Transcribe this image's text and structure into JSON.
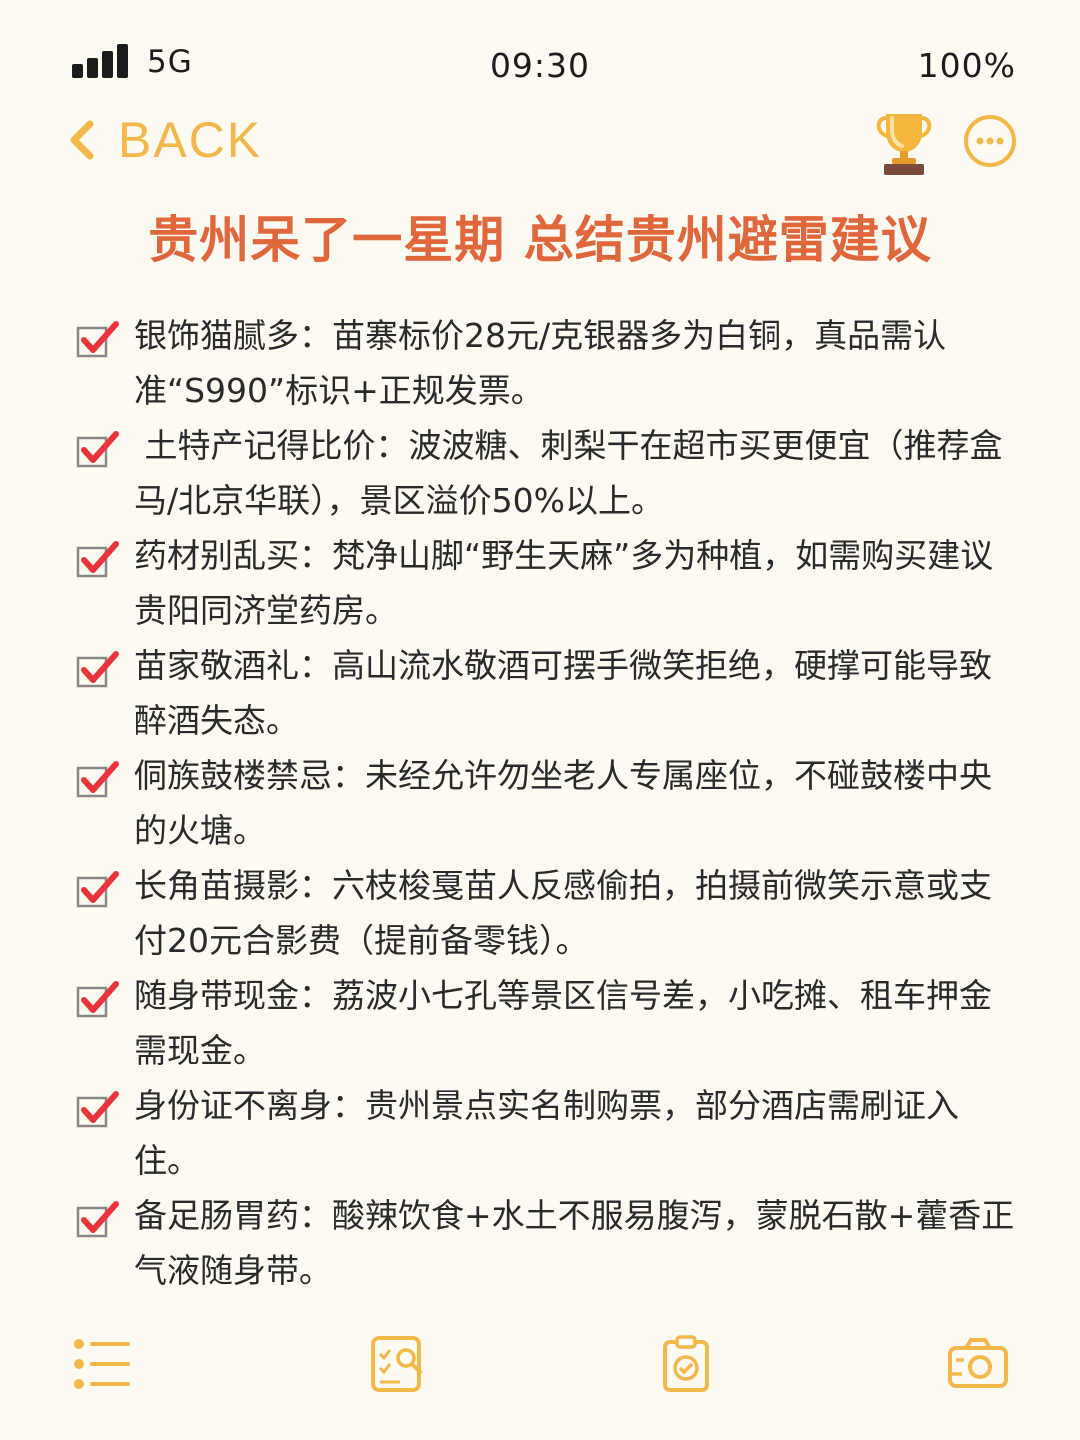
{
  "status_bar": {
    "network": "5G",
    "time": "09:30",
    "battery": "100%"
  },
  "nav": {
    "back_label": "BACK",
    "icons": [
      "chevron-left-icon",
      "trophy-icon",
      "more-icon"
    ]
  },
  "title": "贵州呆了一星期 总结贵州避雷建议",
  "items": [
    {
      "text": "银饰猫腻多：苗寨标价28元/克银器多为白铜，真品需认准“S990”标识+正规发票。"
    },
    {
      "text": " 土特产记得比价：波波糖、刺梨干在超市买更便宜（推荐盒马/北京华联），景区溢价50%以上。"
    },
    {
      "text": "药材别乱买：梵净山脚“野生天麻”多为种植，如需购买建议贵阳同济堂药房。"
    },
    {
      "text": "苗家敬酒礼：高山流水敬酒可摆手微笑拒绝，硬撑可能导致醉酒失态。"
    },
    {
      "text": "侗族鼓楼禁忌：未经允许勿坐老人专属座位，不碰鼓楼中央的火塘。"
    },
    {
      "text": "长角苗摄影：六枝梭戛苗人反感偷拍，拍摄前微笑示意或支付20元合影费（提前备零钱）。"
    },
    {
      "text": "随身带现金：荔波小七孔等景区信号差，小吃摊、租车押金需现金。"
    },
    {
      "text": "身份证不离身：贵州景点实名制购票，部分酒店需刷证入住。"
    },
    {
      "text": "备足肠胃药：酸辣饮食+水土不服易腹泻，蒙脱石散+藿香正气液随身带。"
    }
  ],
  "toolbar": {
    "icons": [
      "list-icon",
      "checklist-search-icon",
      "clipboard-check-icon",
      "camera-icon"
    ]
  },
  "colors": {
    "background": "#fdfaf1",
    "accent": "#f3b74a",
    "title": "#e0663c",
    "check": "#e8343a"
  }
}
